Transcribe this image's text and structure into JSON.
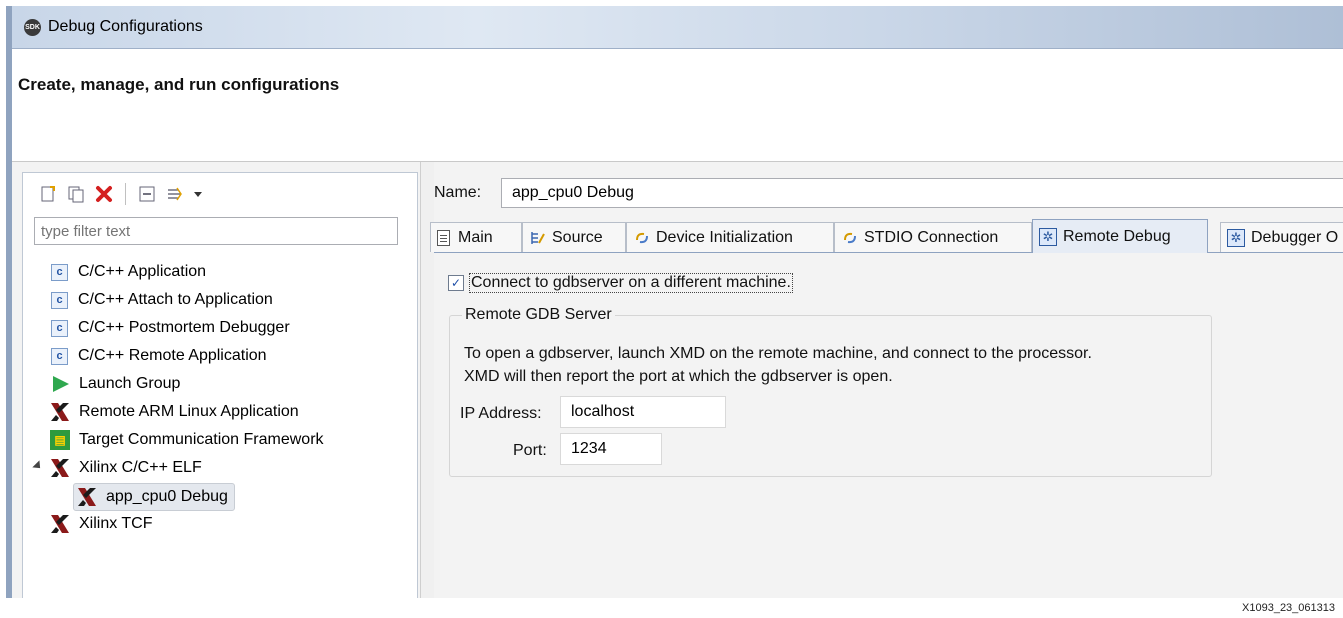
{
  "window": {
    "title": "Debug Configurations",
    "app_icon_text": "SDK"
  },
  "banner": {
    "heading": "Create, manage, and run configurations"
  },
  "left": {
    "filter_placeholder": "type filter text",
    "tree": [
      {
        "label": "C/C++ Application",
        "icon": "c-config-icon"
      },
      {
        "label": "C/C++ Attach to Application",
        "icon": "c-config-icon"
      },
      {
        "label": "C/C++ Postmortem Debugger",
        "icon": "c-config-icon"
      },
      {
        "label": "C/C++ Remote Application",
        "icon": "c-config-icon"
      },
      {
        "label": "Launch Group",
        "icon": "launch-group-icon"
      },
      {
        "label": "Remote ARM Linux Application",
        "icon": "xilinx-icon"
      },
      {
        "label": "Target Communication Framework",
        "icon": "tcf-icon"
      },
      {
        "label": "Xilinx C/C++ ELF",
        "icon": "xilinx-icon",
        "expanded": true
      },
      {
        "label": "app_cpu0 Debug",
        "icon": "xilinx-icon",
        "selected": true
      },
      {
        "label": "Xilinx TCF",
        "icon": "xilinx-icon"
      }
    ]
  },
  "right": {
    "name_label": "Name:",
    "name_value": "app_cpu0 Debug",
    "tabs": [
      {
        "label": "Main",
        "icon": "document-icon"
      },
      {
        "label": "Source",
        "icon": "source-icon"
      },
      {
        "label": "Device Initialization",
        "icon": "device-init-icon"
      },
      {
        "label": "STDIO Connection",
        "icon": "stdio-icon"
      },
      {
        "label": "Remote Debug",
        "icon": "bug-icon",
        "active": true
      },
      {
        "label": "Debugger O",
        "icon": "bug-icon"
      }
    ],
    "connect_checkbox_label": "Connect to gdbserver on a different machine.",
    "connect_checked": true,
    "group_title": "Remote GDB Server",
    "description_line1": "To open a gdbserver, launch XMD on the remote machine, and connect to the processor.",
    "description_line2": "XMD will then report the port at which the gdbserver is open.",
    "ip_label": "IP Address:",
    "ip_value": "localhost",
    "port_label": "Port:",
    "port_value": "1234"
  },
  "caption": "X1093_23_061313",
  "colors": {
    "titlebar": "#dfe8f3",
    "accent": "#2c5aa0",
    "delete_red": "#d42020",
    "play_green": "#2fa84f"
  }
}
